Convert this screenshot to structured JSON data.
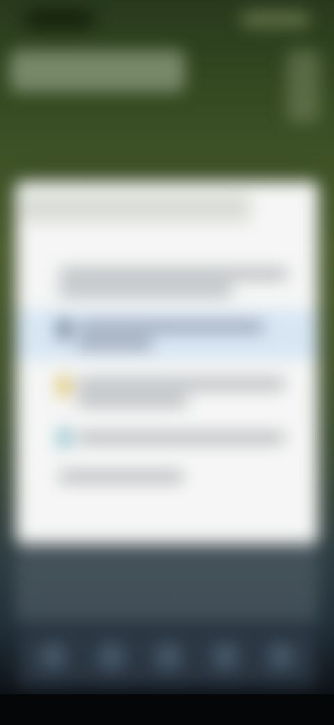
{
  "colors": {
    "background_top": "#283a1c",
    "background_bottom": "#050607",
    "dialog": "#f5f6f5",
    "selected_row": "#d8e6f4",
    "option_icons": [
      "#5a6a7a",
      "#d8b848",
      "#7ab8c4"
    ]
  },
  "dialog": {
    "selected_option_index": 1,
    "option_count": 5
  },
  "toolbar": {
    "icon_names": [
      "toolbar-icon",
      "toolbar-icon",
      "toolbar-icon",
      "toolbar-icon",
      "toolbar-icon"
    ]
  }
}
